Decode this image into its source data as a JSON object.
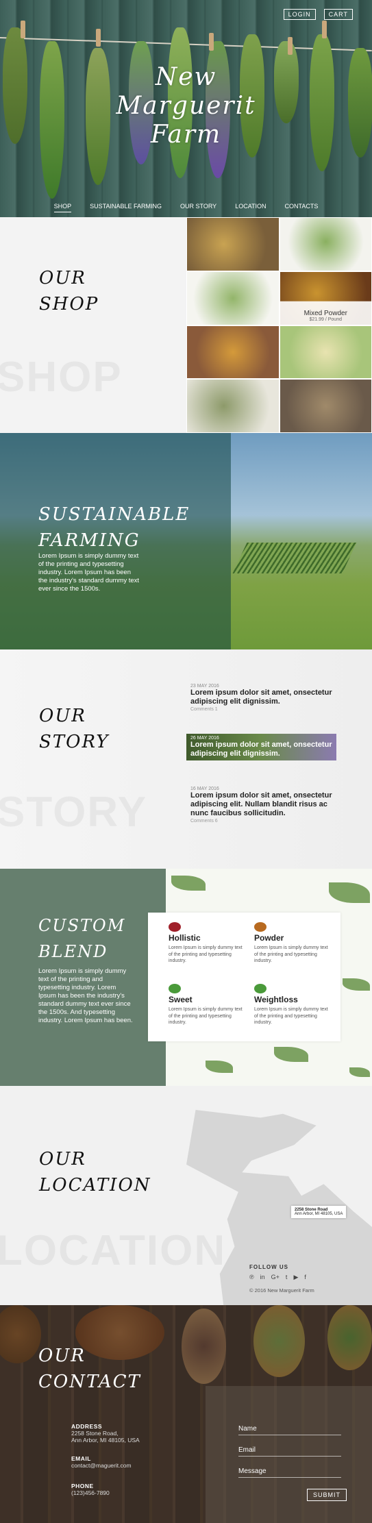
{
  "header": {
    "login": "LOGIN",
    "cart": "CART",
    "title_lines": [
      "New",
      "Marguerit",
      "Farm"
    ]
  },
  "nav": [
    "SHOP",
    "SUSTAINABLE FARMING",
    "OUR STORY",
    "LOCATION",
    "CONTACTS"
  ],
  "shop": {
    "title_lines": [
      "OUR",
      "SHOP"
    ],
    "ghost": "SHOP",
    "featured": {
      "name": "Mixed Powder",
      "price": "$21.99 / Pound"
    }
  },
  "farming": {
    "title_lines": [
      "SUSTAINABLE",
      "FARMING"
    ],
    "desc": "Lorem Ipsum is simply dummy text of the printing and typesetting industry. Lorem Ipsum has been the industry's standard dummy text ever since the 1500s."
  },
  "story": {
    "title_lines": [
      "OUR",
      "STORY"
    ],
    "ghost": "STORY",
    "posts": [
      {
        "date": "23 MAY 2016",
        "title": "Lorem ipsum dolor sit amet, onsectetur adipiscing elit dignissim.",
        "comments": "Comments 1"
      },
      {
        "date": "26 MAY 2016",
        "title": "Lorem ipsum dolor sit amet, onsectetur adipiscing elit dignissim.",
        "comments": ""
      },
      {
        "date": "16 MAY 2016",
        "title": "Lorem ipsum dolor sit amet, onsectetur adipiscing elit. Nullam blandit risus ac nunc faucibus sollicitudin.",
        "comments": "Comments 6"
      }
    ]
  },
  "blend": {
    "title_lines": [
      "CUSTOM",
      "BLEND"
    ],
    "desc": "Lorem Ipsum is simply dummy text of the printing and typesetting industry. Lorem Ipsum has been the industry's standard dummy text ever since the 1500s. And typesetting industry. Lorem Ipsum has been.",
    "items": [
      {
        "name": "Hollistic",
        "desc": "Lorem Ipsum is simply dummy text of the printing and typesetting industry.",
        "color": "#a0202a"
      },
      {
        "name": "Powder",
        "desc": "Lorem Ipsum is simply dummy text of the printing and typesetting industry.",
        "color": "#b86a20"
      },
      {
        "name": "Sweet",
        "desc": "Lorem Ipsum is simply dummy text of the printing and typesetting industry.",
        "color": "#4a9a3a"
      },
      {
        "name": "Weightloss",
        "desc": "Lorem Ipsum is simply dummy text of the printing and typesetting industry.",
        "color": "#4a9a3a"
      }
    ]
  },
  "location": {
    "title_lines": [
      "OUR",
      "LOCATION"
    ],
    "ghost": "LOCATION",
    "pin_lines": [
      "2258 Stone Road",
      "Ann Arbor, MI 48105, USA"
    ],
    "follow": "FOLLOW US",
    "social_icons": [
      "pinterest-icon",
      "linkedin-icon",
      "google-plus-icon",
      "twitter-icon",
      "youtube-icon",
      "facebook-icon"
    ],
    "social_glyphs": [
      "℗",
      "in",
      "G+",
      "t",
      "▶",
      "f"
    ],
    "copyright": "© 2016 New Marguerit Farm"
  },
  "contact": {
    "title_lines": [
      "OUR",
      "CONTACT"
    ],
    "address_label": "ADDRESS",
    "address_lines": [
      "2258 Stone Road,",
      "Ann Arbor, MI 48105, USA"
    ],
    "email_label": "EMAIL",
    "email": "contact@maguerit.com",
    "phone_label": "PHONE",
    "phone": "(123)456-7890",
    "form": {
      "name": "Name",
      "email": "Email",
      "message": "Message",
      "submit": "SUBMIT"
    }
  }
}
